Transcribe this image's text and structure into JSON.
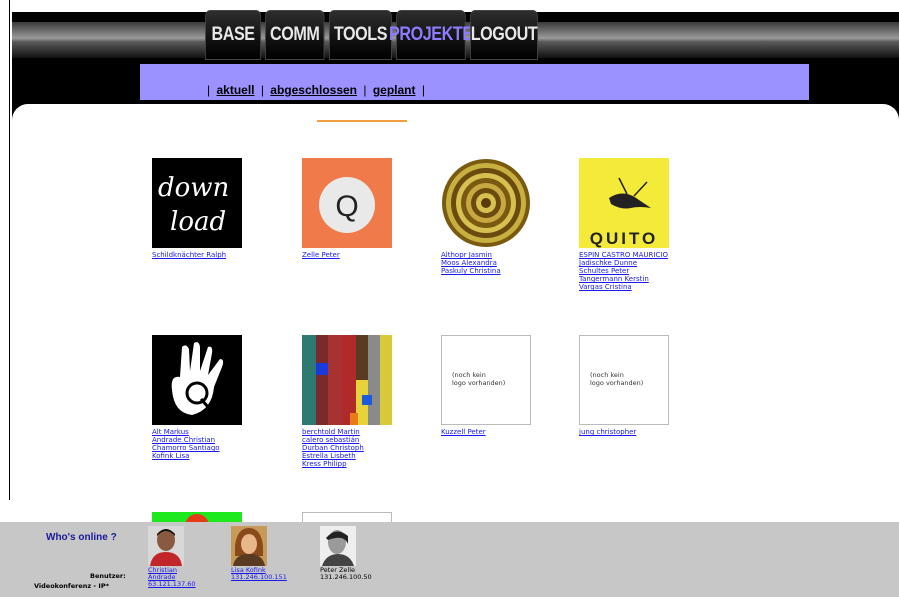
{
  "nav": {
    "tabs": [
      {
        "label": "BASE",
        "active": false
      },
      {
        "label": "COMM",
        "active": false
      },
      {
        "label": "TOOLS",
        "active": false
      },
      {
        "label": "PROJEKTE",
        "active": true
      },
      {
        "label": "LOGOUT",
        "active": false
      }
    ],
    "subnav": [
      {
        "label": "aktuell"
      },
      {
        "label": "abgeschlossen"
      },
      {
        "label": "geplant"
      }
    ],
    "separator": "|"
  },
  "projects": [
    {
      "logo_text": [
        "down",
        "load"
      ],
      "names": [
        "Schildknächter Ralph"
      ]
    },
    {
      "logo_text": "Q",
      "names": [
        "Zelle Peter"
      ]
    },
    {
      "logo_text": "",
      "names": [
        "Althopr Jasmin",
        "Moos Alexandra",
        "Paskuly Christina"
      ]
    },
    {
      "logo_text": "QUITO",
      "names": [
        "ESPIN CASTRO MAURICIO",
        "Jadischke Dunne",
        "Schultes Peter",
        "Tangermann Kerstin",
        "Vargas Cristina"
      ]
    },
    {
      "logo_text": "",
      "names": [
        "Alt Markus",
        "Andrade Christian",
        "Chamorro Santiago",
        "Kofink Lisa"
      ]
    },
    {
      "logo_text": "",
      "names": [
        "berchtold Martin",
        "calero sebastián",
        "Durban Christoph",
        "Estrella Lisbeth",
        "Kress Philipp"
      ]
    },
    {
      "logo_text": [
        "(noch kein",
        "logo vorhanden)"
      ],
      "names": [
        "Kuzzell Peter"
      ]
    },
    {
      "logo_text": [
        "(noch kein",
        "logo vorhanden)"
      ],
      "names": [
        "jung christopher"
      ]
    },
    {
      "logo_text": "",
      "names": []
    },
    {
      "logo_text": "",
      "names": []
    }
  ],
  "footer": {
    "title": "Who's online ?",
    "user_label": "Benutzer:",
    "video_label": "Videokonferenz - IP*",
    "users": [
      {
        "name": "Christian",
        "surname": "Andrade",
        "ip": "63.121.137.60",
        "linked": true
      },
      {
        "name": "Lisa Kofink",
        "surname": "",
        "ip": "131.246.100.151",
        "linked": true
      },
      {
        "name": "Peter Zelle",
        "surname": "",
        "ip": "131.246.100.50",
        "linked": false
      }
    ]
  },
  "colors": {
    "subnav_bg": "#9b92ff",
    "active_tab": "#8d7cff",
    "link": "#1a1aee",
    "footer_bg": "#c7c7c7",
    "accent": "#f0a040"
  }
}
